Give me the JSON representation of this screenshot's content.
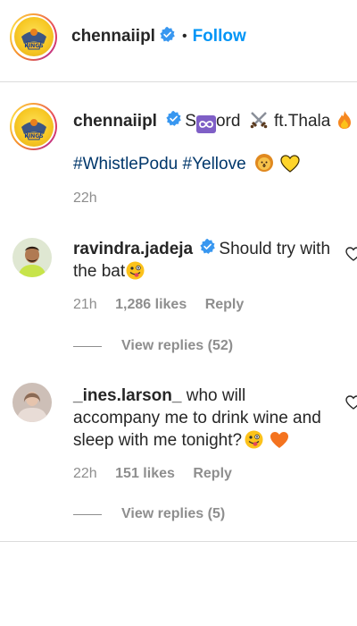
{
  "header": {
    "username": "chennaiipl",
    "separator": "•",
    "follow_label": "Follow"
  },
  "caption": {
    "username": "chennaiipl",
    "text_s": "S",
    "text_ord": "ord",
    "text_ft": "ft.Thala",
    "hashtags": "#WhistlePodu #Yellove",
    "time": "22h"
  },
  "comments": [
    {
      "username": "ravindra.jadeja",
      "verified": true,
      "text": "Should try with the bat",
      "time": "21h",
      "likes": "1,286 likes",
      "reply_label": "Reply",
      "view_replies": "View replies (52)"
    },
    {
      "username": "_ines.larson_",
      "verified": false,
      "text": "who will accompany me to drink wine and sleep with me tonight?",
      "time": "22h",
      "likes": "151 likes",
      "reply_label": "Reply",
      "view_replies": "View replies (5)"
    }
  ],
  "icons": {
    "verified": "verified-badge-icon",
    "heart": "heart-outline-icon",
    "infinity": "infinity-emoji-icon",
    "swords": "crossed-swords-emoji-icon",
    "fire": "fire-emoji-icon",
    "lion": "lion-emoji-icon",
    "yellow_heart": "yellow-heart-emoji-icon",
    "tongue_face": "zany-face-emoji-icon",
    "orange_heart": "orange-heart-emoji-icon"
  },
  "colors": {
    "follow": "#0095f6",
    "hashtag": "#00376b",
    "verified": "#3897f0",
    "meta": "#8e8e8e",
    "divider": "#dbdbdb"
  }
}
